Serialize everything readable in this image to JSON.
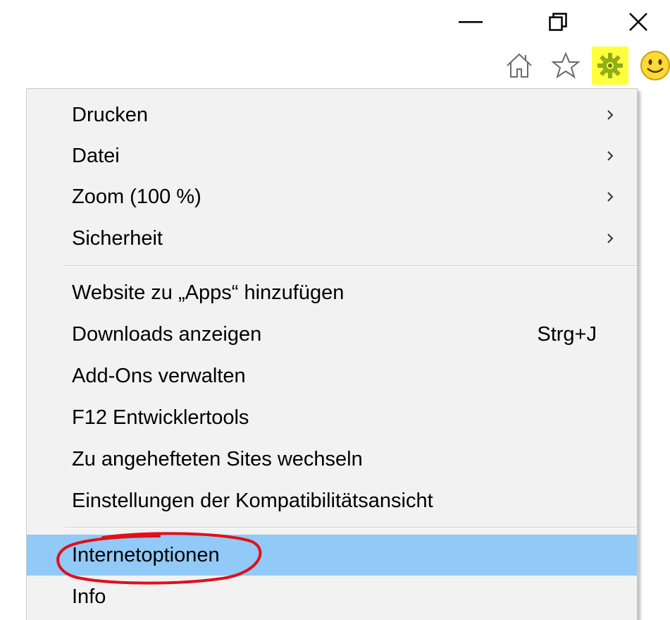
{
  "window": {
    "minimize_glyph": "—",
    "restore_glyph": "restore",
    "close_glyph": "✕"
  },
  "toolbar": {
    "icons": [
      "home-icon",
      "star-icon",
      "gear-icon",
      "smiley-icon"
    ],
    "gear_highlight_color": "#ffff3d"
  },
  "menu": {
    "items": [
      {
        "label": "Drucken",
        "submenu": true
      },
      {
        "label": "Datei",
        "submenu": true
      },
      {
        "label": "Zoom (100 %)",
        "submenu": true
      },
      {
        "label": "Sicherheit",
        "submenu": true
      },
      {
        "label": "Website zu „Apps“ hinzufügen"
      },
      {
        "label": "Downloads anzeigen",
        "shortcut": "Strg+J"
      },
      {
        "label": "Add-Ons verwalten"
      },
      {
        "label": "F12 Entwicklertools"
      },
      {
        "label": "Zu angehefteten Sites wechseln"
      },
      {
        "label": "Einstellungen der Kompatibilitätsansicht"
      },
      {
        "label": "Internetoptionen",
        "highlighted": true
      },
      {
        "label": "Info"
      }
    ],
    "highlight_color": "#91c9f7",
    "annotation_color": "#e0101a"
  }
}
